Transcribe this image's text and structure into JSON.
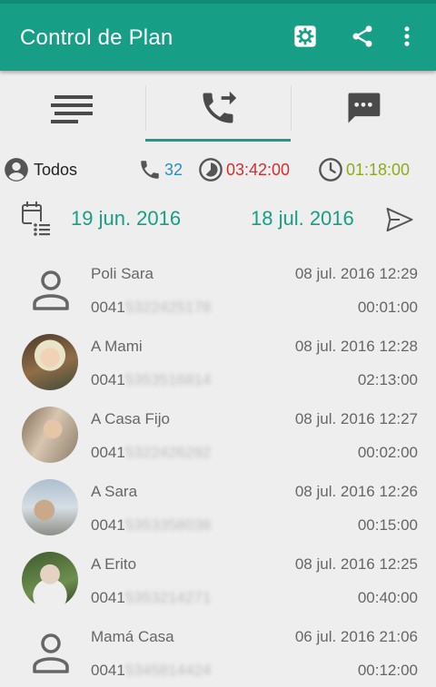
{
  "appbar": {
    "title": "Control de Plan",
    "icons": [
      "settings-icon",
      "share-icon",
      "overflow-menu-icon"
    ]
  },
  "tabs": [
    {
      "name": "summary-list",
      "icon": "list-icon",
      "selected": false
    },
    {
      "name": "calls",
      "icon": "phone-forwarded-icon",
      "selected": true
    },
    {
      "name": "messages",
      "icon": "message-icon",
      "selected": false
    }
  ],
  "stats": {
    "contacts_label": "Todos",
    "call_count": "32",
    "time_consumed": "03:42:00",
    "time_remaining": "01:18:00",
    "colors": {
      "count": "#2a8fbf",
      "consumed": "#d32f2f",
      "remaining": "#8bab1f",
      "accent": "#179e86"
    }
  },
  "date_range": {
    "start": "19 jun. 2016",
    "end": "18 jul. 2016"
  },
  "calls": [
    {
      "name": "Poli Sara",
      "number_prefix": "0041",
      "number_rest": "5322425178",
      "datetime": "08 jul. 2016 12:29",
      "duration": "00:01:00",
      "avatar": "default"
    },
    {
      "name": "A Mami",
      "number_prefix": "0041",
      "number_rest": "5353516814",
      "datetime": "08 jul. 2016 12:28",
      "duration": "02:13:00",
      "avatar": "photo"
    },
    {
      "name": "A Casa Fijo",
      "number_prefix": "0041",
      "number_rest": "5322426292",
      "datetime": "08 jul. 2016 12:27",
      "duration": "00:02:00",
      "avatar": "photo"
    },
    {
      "name": "A Sara",
      "number_prefix": "0041",
      "number_rest": "5353358038",
      "datetime": "08 jul. 2016 12:26",
      "duration": "00:15:00",
      "avatar": "photo"
    },
    {
      "name": "A Erito",
      "number_prefix": "0041",
      "number_rest": "5353214271",
      "datetime": "08 jul. 2016 12:25",
      "duration": "00:40:00",
      "avatar": "photo"
    },
    {
      "name": "Mamá Casa",
      "number_prefix": "0041",
      "number_rest": "5345814424",
      "datetime": "06 jul. 2016 21:06",
      "duration": "00:12:00",
      "avatar": "default"
    }
  ]
}
